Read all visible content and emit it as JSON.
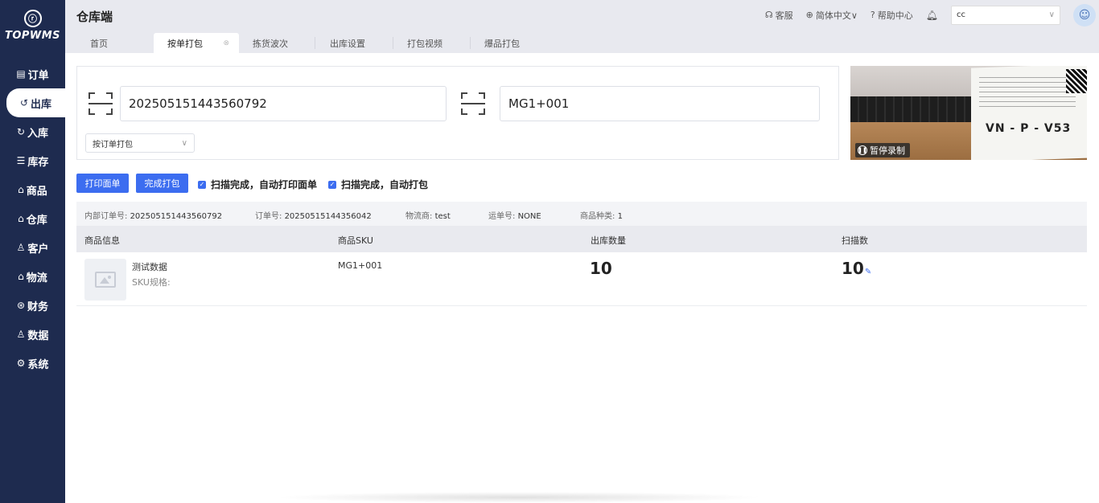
{
  "sidebar": {
    "logo_text": "TOPWMS",
    "items": [
      {
        "icon": "clipboard-icon",
        "glyph": "▤",
        "label": "订单"
      },
      {
        "icon": "outbound-icon",
        "glyph": "↺",
        "label": "出库"
      },
      {
        "icon": "inbound-icon",
        "glyph": "↻",
        "label": "入库"
      },
      {
        "icon": "inventory-icon",
        "glyph": "☰",
        "label": "库存"
      },
      {
        "icon": "bag-icon",
        "glyph": "⌂",
        "label": "商品"
      },
      {
        "icon": "warehouse-icon",
        "glyph": "⌂",
        "label": "仓库"
      },
      {
        "icon": "users-icon",
        "glyph": "♙",
        "label": "客户"
      },
      {
        "icon": "logistics-icon",
        "glyph": "⌂",
        "label": "物流"
      },
      {
        "icon": "finance-icon",
        "glyph": "⊛",
        "label": "财务"
      },
      {
        "icon": "data-icon",
        "glyph": "♙",
        "label": "数据"
      },
      {
        "icon": "settings-icon",
        "glyph": "⚙",
        "label": "系统"
      }
    ]
  },
  "header": {
    "title": "仓库端",
    "links": [
      {
        "icon": "headset-icon",
        "glyph": "☊",
        "label": "客服"
      },
      {
        "icon": "globe-icon",
        "glyph": "⊕",
        "label": "简体中文∨"
      },
      {
        "icon": "help-icon",
        "glyph": "?",
        "label": "帮助中心"
      }
    ],
    "user_value": "cc"
  },
  "tabs": [
    {
      "label": "首页"
    },
    {
      "label": "按单打包"
    },
    {
      "label": "拣货波次"
    },
    {
      "label": "出库设置"
    },
    {
      "label": "打包视频"
    },
    {
      "label": "爆品打包"
    }
  ],
  "scan": {
    "order_value": "202505151443560792",
    "sku_value": "MG1+001",
    "mode": "按订单打包"
  },
  "camera": {
    "label_text": "VN - P - V53",
    "pause_label": "暂停录制"
  },
  "actions": {
    "print_label": "打印面单",
    "complete_label": "完成打包",
    "auto_print_label": "扫描完成，自动打印面单",
    "auto_pack_label": "扫描完成，自动打包"
  },
  "order_info": {
    "internal_no_label": "内部订单号:",
    "internal_no": "202505151443560792",
    "order_no_label": "订单号:",
    "order_no": "20250515144356042",
    "carrier_label": "物流商:",
    "carrier": "test",
    "tracking_label": "运单号:",
    "tracking": "NONE",
    "kinds_label": "商品种类:",
    "kinds": "1"
  },
  "table": {
    "headers": [
      "商品信息",
      "商品SKU",
      "出库数量",
      "扫描数"
    ],
    "rows": [
      {
        "name": "测试数据",
        "spec": "SKU规格:",
        "sku": "MG1+001",
        "out_qty": "10",
        "scan_qty": "10"
      }
    ]
  },
  "colors": {
    "sidebar": "#1e2b4f",
    "accent": "#3c6df0"
  }
}
